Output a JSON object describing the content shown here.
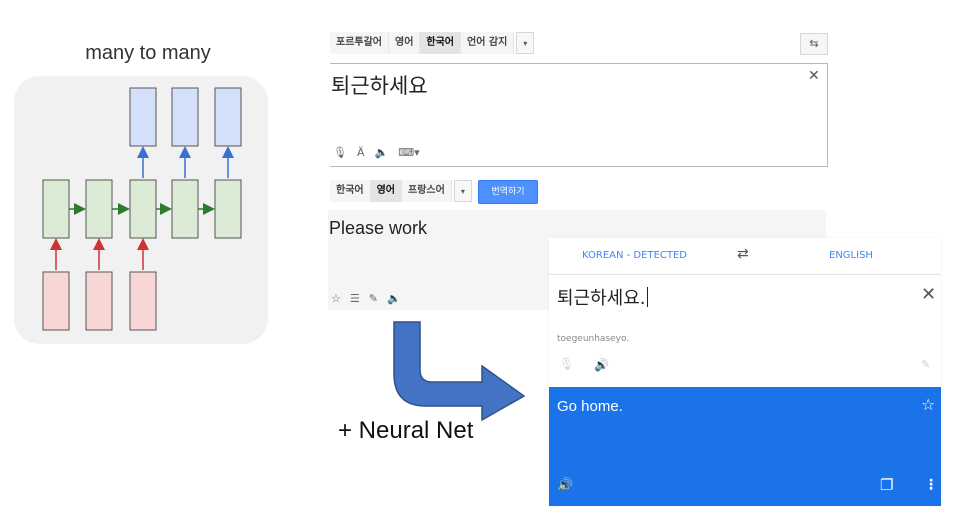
{
  "diagram": {
    "title": "many to many"
  },
  "old_translate": {
    "source_tabs": [
      {
        "label": "포르투갈어"
      },
      {
        "label": "영어"
      },
      {
        "label": "한국어",
        "active": true
      },
      {
        "label": "언어 감지"
      }
    ],
    "source_text": "퇴근하세요",
    "source_tool_icons": [
      "mic-icon",
      "keyboard-accent-icon",
      "speaker-icon",
      "keyboard-icon"
    ],
    "target_tabs": [
      {
        "label": "한국어"
      },
      {
        "label": "영어",
        "active": true
      },
      {
        "label": "프랑스어"
      }
    ],
    "translate_button": "번역하기",
    "result_text": "Please work",
    "result_tool_icons": [
      "star-icon",
      "list-icon",
      "pencil-icon",
      "speaker-icon"
    ]
  },
  "annotation": {
    "label": "+ Neural Net"
  },
  "new_translate": {
    "source_language": "KOREAN - DETECTED",
    "target_language": "ENGLISH",
    "input_text": "퇴근하세요.",
    "romanization": "toegeunhaseyo.",
    "output_text": "Go home.",
    "accent_color": "#1a73e8",
    "link_color": "#4285f4"
  }
}
